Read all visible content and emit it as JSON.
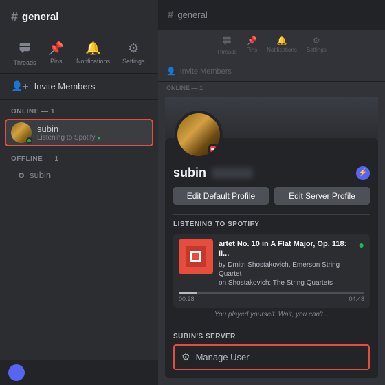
{
  "left": {
    "channel": {
      "hash": "#",
      "name": "general"
    },
    "actions": [
      {
        "icon": "⧖",
        "label": "Threads"
      },
      {
        "icon": "📌",
        "label": "Pins"
      },
      {
        "icon": "🔔",
        "label": "Notifications"
      },
      {
        "icon": "⚙",
        "label": "Settings"
      }
    ],
    "invite": {
      "icon": "👤",
      "label": "Invite Members"
    },
    "online": {
      "section_label": "ONLINE — 1",
      "member": {
        "name": "subin",
        "status": "Listening to Spotify"
      }
    },
    "offline": {
      "section_label": "OFFLINE — 1",
      "member": {
        "name": "subin"
      }
    }
  },
  "right": {
    "channel": {
      "hash": "#",
      "name": "general"
    },
    "actions": [
      {
        "icon": "⧖",
        "label": "Threads"
      },
      {
        "icon": "📌",
        "label": "Pins"
      },
      {
        "icon": "🔔",
        "label": "Notifications"
      },
      {
        "icon": "⚙",
        "label": "Settings"
      }
    ],
    "invite": {
      "icon": "👤",
      "label": "Invite Members"
    },
    "online_label": "ONLINE — 1",
    "profile": {
      "username": "subin",
      "discriminator": "####",
      "edit_default_label": "Edit Default Profile",
      "edit_server_label": "Edit Server Profile",
      "spotify": {
        "section_label": "LISTENING TO SPOTIFY",
        "song": "artet No. 10 in A Flat Major, Op. 118: II...",
        "artist": "by Dmitri Shostakovich, Emerson String Quartet",
        "album_info": "on Shostakovich: The String Quartets",
        "progress_current": "00:28",
        "progress_total": "04:48",
        "progress_pct": 10,
        "playing_text": "You played yourself. Wait, you can't..."
      },
      "server_section": "SUBIN'S SERVER",
      "manage_user": {
        "icon": "⚙",
        "label": "Manage User"
      }
    }
  }
}
